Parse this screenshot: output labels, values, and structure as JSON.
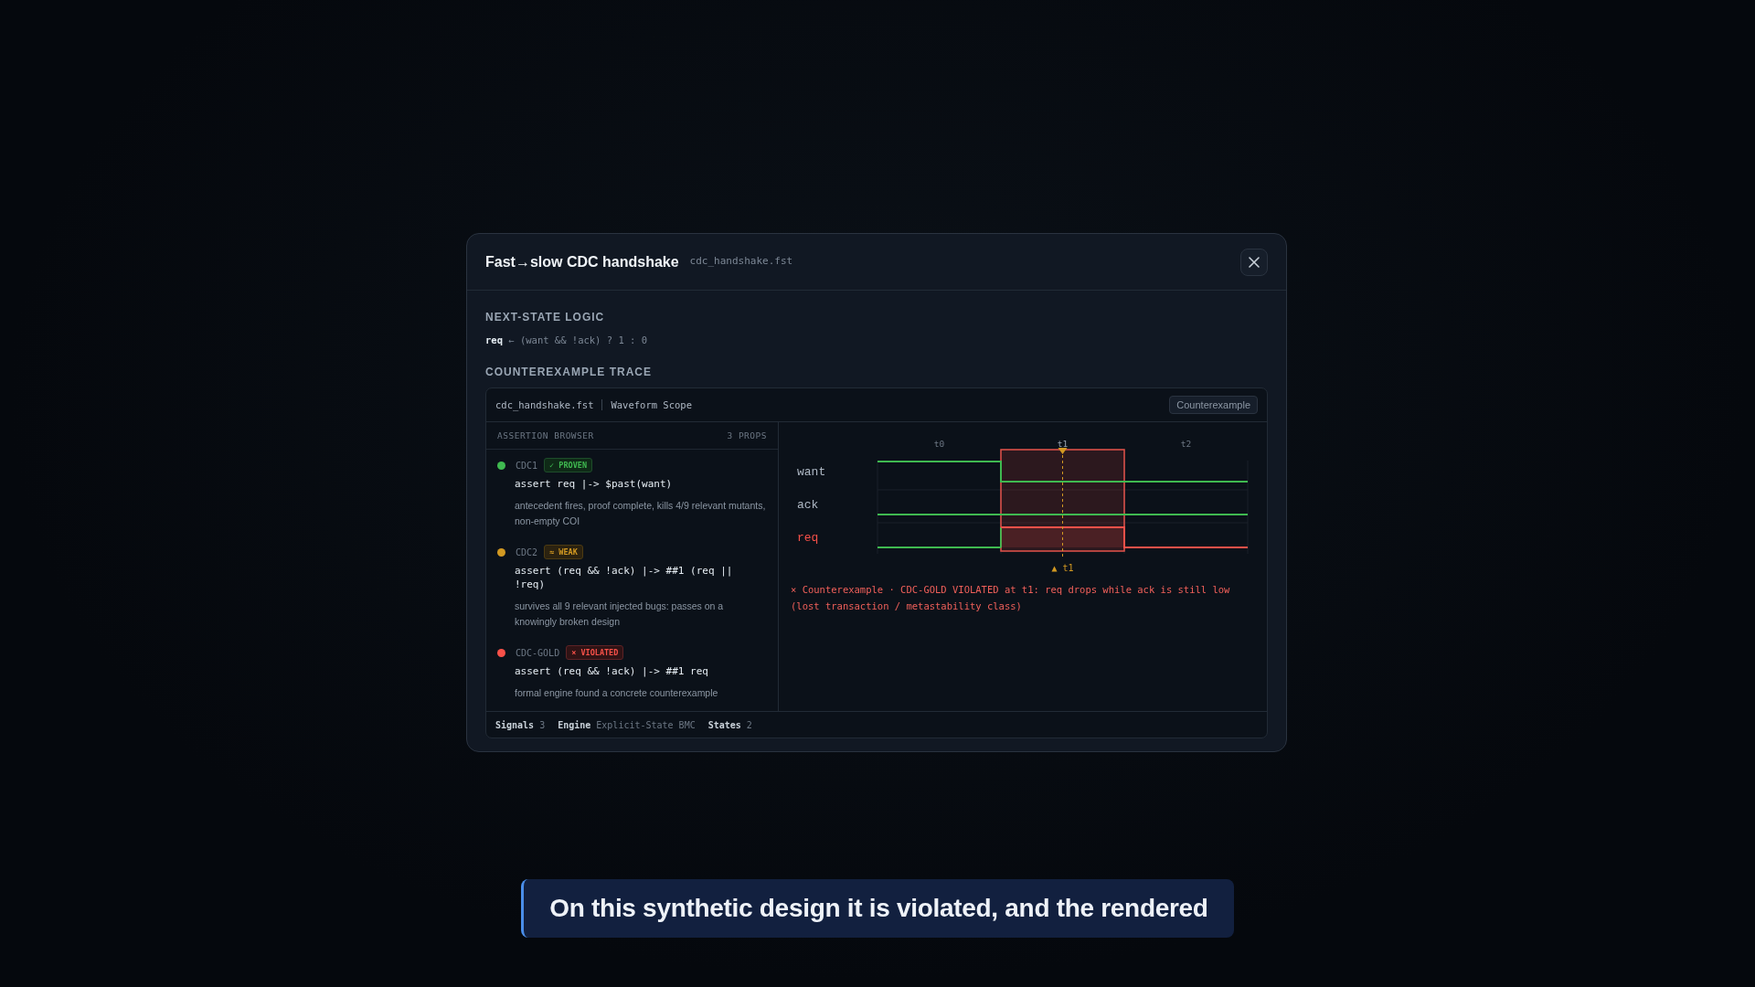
{
  "modal": {
    "title": "Fast→slow CDC handshake",
    "file": "cdc_handshake.fst",
    "next_state": {
      "heading": "NEXT-STATE LOGIC",
      "logic": "**req** ← (want && !ack) ? 1 : 0"
    },
    "trace": {
      "heading": "COUNTEREXAMPLE TRACE",
      "file": "cdc_handshake.fst",
      "view": "Waveform Scope",
      "badge": "Counterexample",
      "browser": {
        "title": "ASSERTION BROWSER",
        "count": "3 PROPS",
        "assertions": [
          {
            "id": "CDC1",
            "kind": "proven",
            "badge": "✓ PROVEN",
            "code": "assert req |-> $past(want)",
            "note": "antecedent fires, proof complete, kills 4/9 relevant mutants, non-empty COI"
          },
          {
            "id": "CDC2",
            "kind": "weak",
            "badge": "≈ WEAK",
            "code": "assert (req && !ack) |-> ##1 (req || !req)",
            "note": "survives all 9 relevant injected bugs: passes on a knowingly broken design"
          },
          {
            "id": "CDC-GOLD",
            "kind": "violated",
            "badge": "× VIOLATED",
            "code": "assert (req && !ack) |-> ##1 req",
            "note": "formal engine found a concrete counterexample"
          }
        ]
      },
      "waveform": {
        "ticks": [
          {
            "label": "t0",
            "selected": false
          },
          {
            "label": "t1",
            "selected": true
          },
          {
            "label": "t2",
            "selected": false
          }
        ],
        "marker": "▲ t1",
        "signals": [
          {
            "name": "want",
            "kind": "falling",
            "violated": false
          },
          {
            "name": "ack",
            "kind": "low",
            "violated": false
          },
          {
            "name": "req",
            "kind": "pulse",
            "violated": true
          }
        ],
        "message": "× Counterexample · CDC-GOLD VIOLATED at t1: req drops while ack is still low (lost transaction / metastability class)"
      },
      "stats": [
        {
          "label": "Signals",
          "value": "3"
        },
        {
          "label": "Engine",
          "value": "Explicit-State BMC"
        },
        {
          "label": "States",
          "value": "2"
        }
      ]
    }
  },
  "caption": "On this synthetic design it is violated, and the rendered"
}
